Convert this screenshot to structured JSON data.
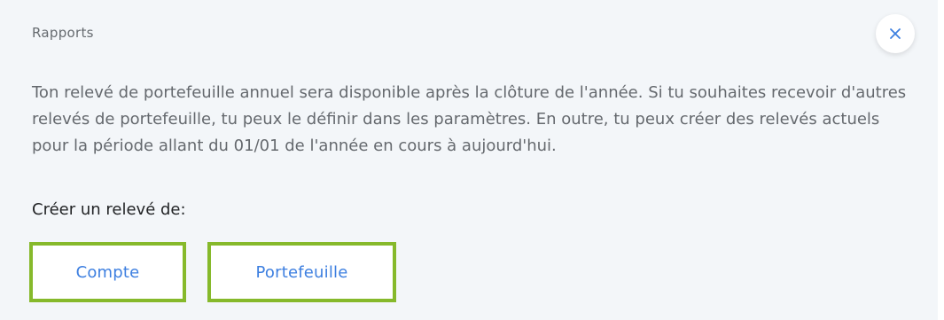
{
  "header": {
    "title": "Rapports",
    "close_icon": "close-icon"
  },
  "description": "Ton relevé de portefeuille annuel sera disponible après la clôture de l'année. Si tu souhaites recevoir d'autres relevés de portefeuille, tu peux le définir dans les paramètres. En outre, tu peux créer des relevés actuels pour la période allant du 01/01 de l'année en cours à aujourd'hui.",
  "create_section": {
    "label": "Créer un relevé de:",
    "buttons": [
      {
        "label": "Compte"
      },
      {
        "label": "Portefeuille"
      }
    ]
  },
  "colors": {
    "background": "#f3f6f9",
    "accent_blue": "#3d7fe0",
    "highlight_green": "#86b92b"
  }
}
